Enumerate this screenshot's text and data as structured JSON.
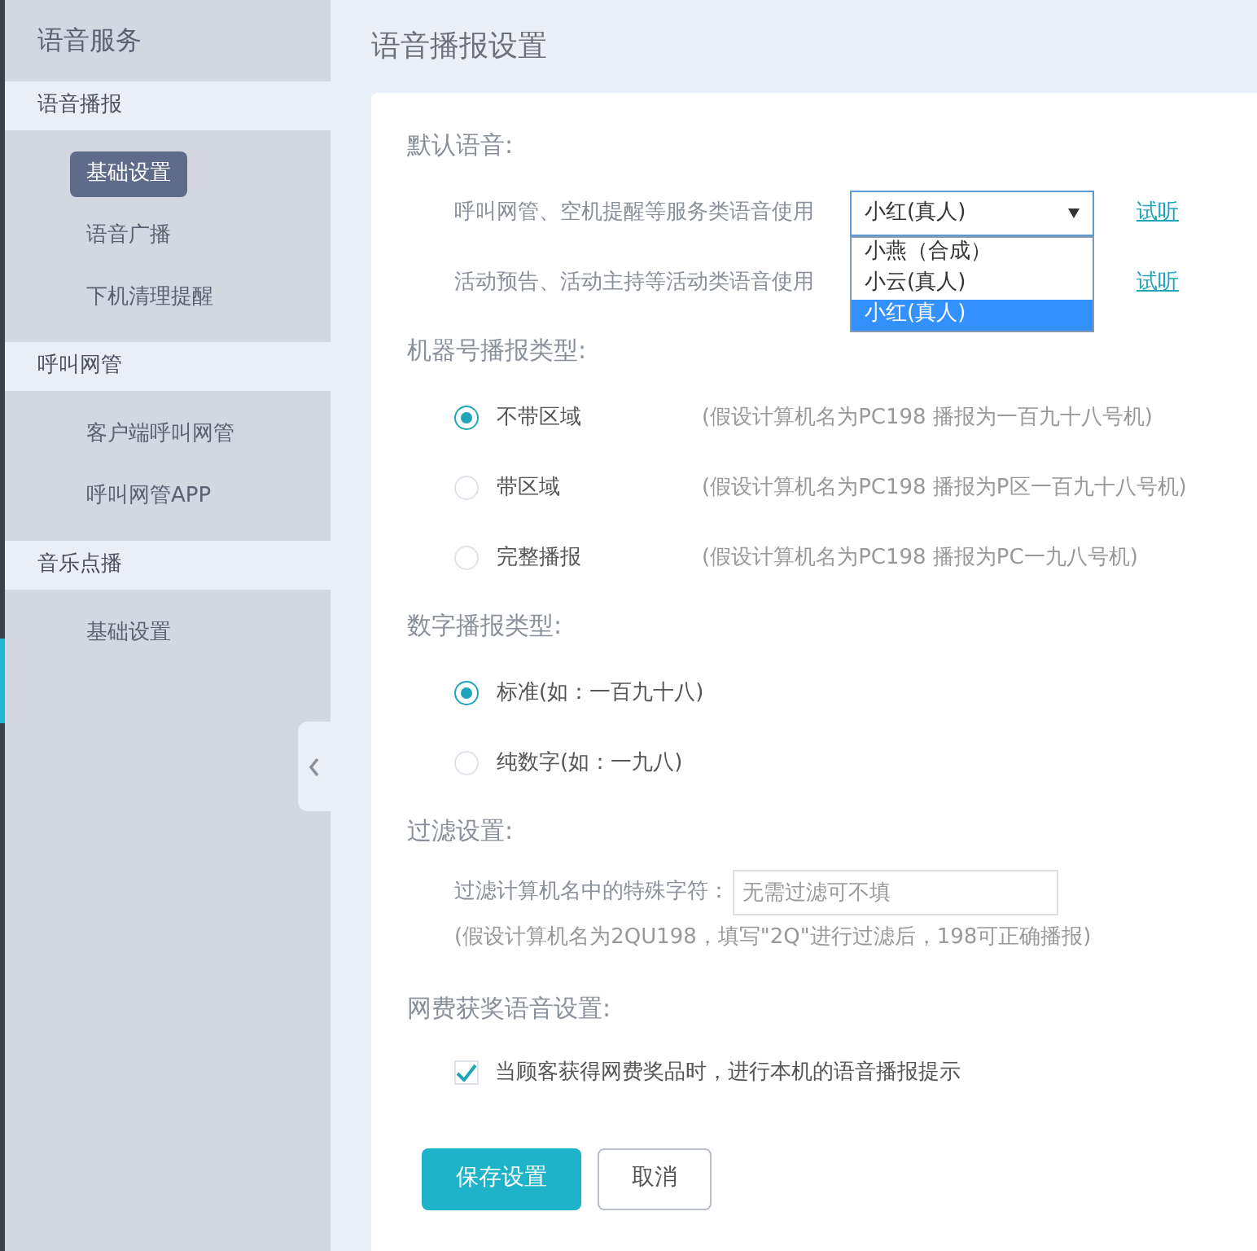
{
  "sidebar": {
    "title": "语音服务",
    "groups": [
      {
        "label": "语音播报",
        "items": [
          {
            "label": "基础设置",
            "selected": true
          },
          {
            "label": "语音广播",
            "selected": false
          },
          {
            "label": "下机清理提醒",
            "selected": false
          }
        ]
      },
      {
        "label": "呼叫网管",
        "items": [
          {
            "label": "客户端呼叫网管",
            "selected": false
          },
          {
            "label": "呼叫网管APP",
            "selected": false
          }
        ]
      },
      {
        "label": "音乐点播",
        "items": [
          {
            "label": "基础设置",
            "selected": false
          }
        ]
      }
    ]
  },
  "page_title": "语音播报设置",
  "default_voice": {
    "heading": "默认语音:",
    "rows": [
      {
        "label": "呼叫网管、空机提醒等服务类语音使用",
        "value": "小红(真人)",
        "expanded": true,
        "options": [
          {
            "label": "小燕（合成）",
            "selected": false
          },
          {
            "label": "小云(真人)",
            "selected": false
          },
          {
            "label": "小红(真人)",
            "selected": true
          }
        ],
        "link": "试听"
      },
      {
        "label": "活动预告、活动主持等活动类语音使用",
        "link": "试听"
      }
    ]
  },
  "machine_type": {
    "heading": "机器号播报类型:",
    "options": [
      {
        "label": "不带区域",
        "hint": "(假设计算机名为PC198 播报为一百九十八号机)",
        "selected": true
      },
      {
        "label": "带区域",
        "hint": "(假设计算机名为PC198 播报为P区一百九十八号机)",
        "selected": false
      },
      {
        "label": "完整播报",
        "hint": "(假设计算机名为PC198 播报为PC一九八号机)",
        "selected": false
      }
    ]
  },
  "number_type": {
    "heading": "数字播报类型:",
    "options": [
      {
        "label": "标准(如：一百九十八)",
        "selected": true
      },
      {
        "label": "纯数字(如：一九八)",
        "selected": false
      }
    ]
  },
  "filter": {
    "heading": "过滤设置:",
    "label": "过滤计算机名中的特殊字符：",
    "placeholder": "无需过滤可不填",
    "note": "(假设计算机名为2QU198，填写\"2Q\"进行过滤后，198可正确播报)"
  },
  "prize": {
    "heading": "网费获奖语音设置:",
    "checkbox": {
      "label": "当顾客获得网费奖品时，进行本机的语音播报提示",
      "checked": true
    }
  },
  "buttons": [
    {
      "label": "保存设置",
      "kind": "primary"
    },
    {
      "label": "取消",
      "kind": "secondary"
    }
  ]
}
